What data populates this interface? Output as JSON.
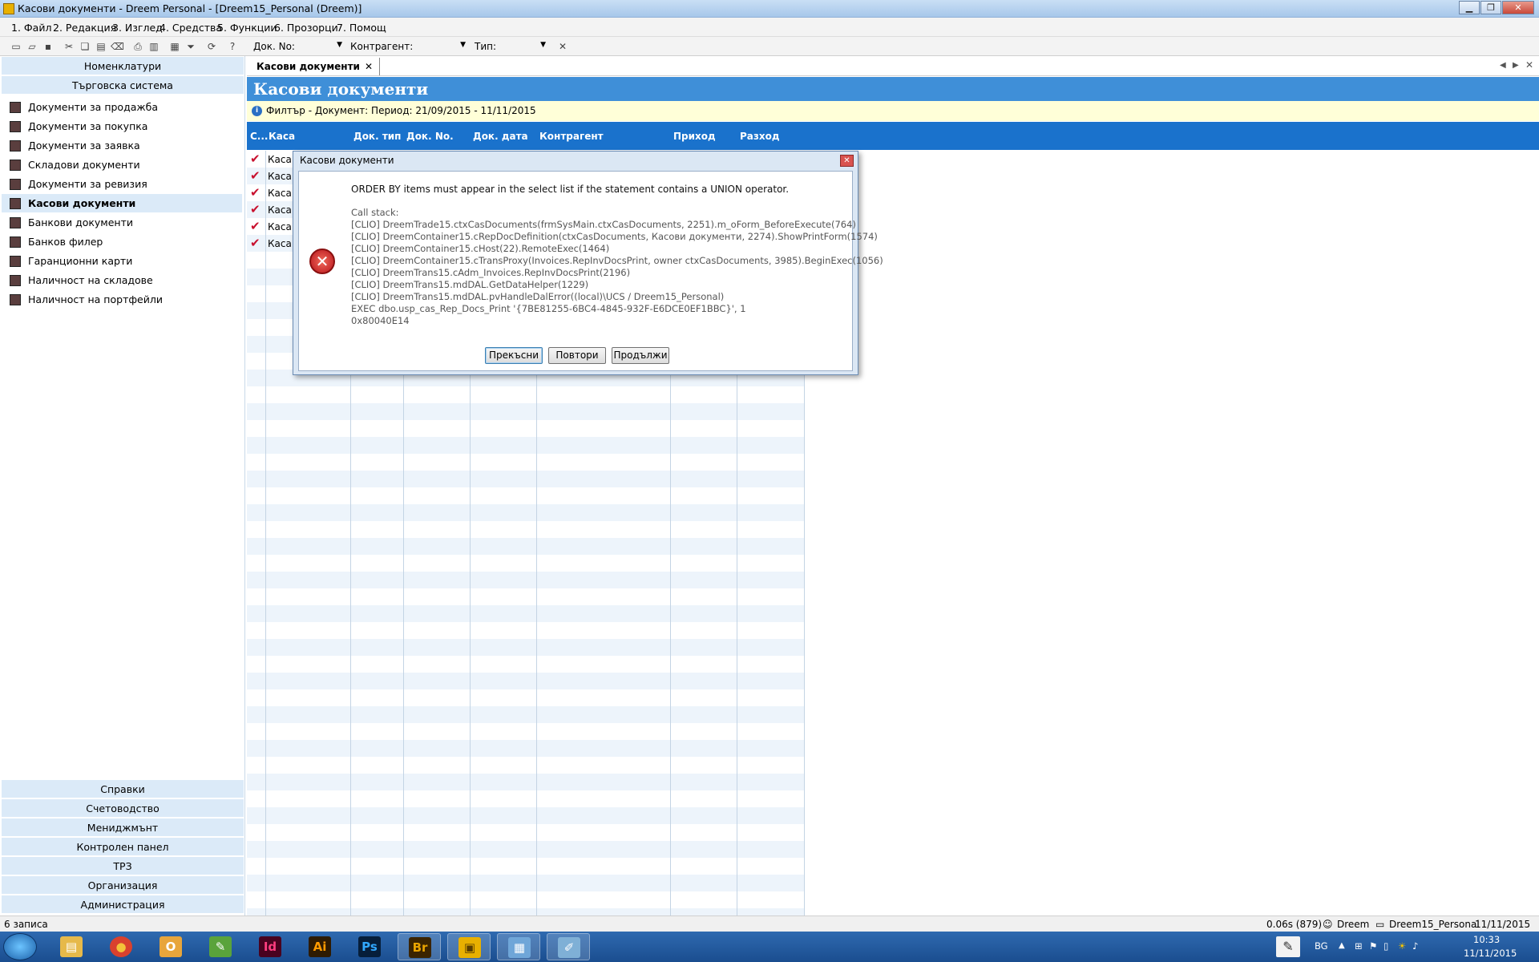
{
  "window": {
    "title": "Касови документи - Dreem Personal - [Dreem15_Personal (Dreem)]",
    "min_glyph": "▁",
    "restore_glyph": "❐",
    "close_glyph": "✕"
  },
  "menu": [
    "1. Файл",
    "2. Редакция",
    "3. Изглед",
    "4. Средства",
    "5. Функции",
    "6. Прозорци",
    "7. Помощ"
  ],
  "toolbar": {
    "doc_no_label": "Док. No:",
    "contragent_label": "Контрагент:",
    "type_label": "Тип:",
    "doc_no_value": "",
    "contragent_value": "",
    "type_value": "",
    "clear_glyph": "✕",
    "icons": [
      "new-icon",
      "open-icon",
      "save-icon",
      "cut-icon",
      "copy-icon",
      "paste-icon",
      "erase-icon",
      "print-icon",
      "print-preview-icon",
      "layout-icon",
      "filter-icon",
      "refresh-icon",
      "help-icon"
    ]
  },
  "sidebar": {
    "top_groups": [
      "Номенклатури",
      "Търговска система"
    ],
    "items": [
      {
        "label": "Документи за продажба",
        "active": false
      },
      {
        "label": "Документи за покупка",
        "active": false
      },
      {
        "label": "Документи за заявка",
        "active": false
      },
      {
        "label": "Складови документи",
        "active": false
      },
      {
        "label": "Документи за ревизия",
        "active": false
      },
      {
        "label": "Касови документи",
        "active": true
      },
      {
        "label": "Банкови документи",
        "active": false
      },
      {
        "label": "Банков филер",
        "active": false
      },
      {
        "label": "Гаранционни карти",
        "active": false
      },
      {
        "label": "Наличност на складове",
        "active": false
      },
      {
        "label": "Наличност на портфейли",
        "active": false
      }
    ],
    "bottom_groups": [
      "Справки",
      "Счетоводство",
      "Мениджмънт",
      "Контролен панел",
      "ТРЗ",
      "Организация",
      "Администрация"
    ]
  },
  "tab": {
    "label": "Касови документи",
    "close": "✕",
    "prev": "◀",
    "next": "▶",
    "close_all": "✕"
  },
  "banner": {
    "title": "Касови документи"
  },
  "filter": {
    "icon": "i",
    "text": "Филтър - Документ: Период: 21/09/2015 - 11/11/2015"
  },
  "grid": {
    "columns": [
      "С...",
      "Каса",
      "Док. тип",
      "Док. No.",
      "Док. дата",
      "Контрагент",
      "Приход",
      "Разход"
    ],
    "check_glyph": "✔",
    "rows": [
      {
        "kasa": "Каса"
      },
      {
        "kasa": "Каса"
      },
      {
        "kasa": "Каса"
      },
      {
        "kasa": "Каса"
      },
      {
        "kasa": "Каса"
      },
      {
        "kasa": "Каса"
      }
    ]
  },
  "dialog": {
    "title": "Касови документи",
    "close_glyph": "✕",
    "error_glyph": "✕",
    "message": "ORDER BY items must appear in the select list if the statement contains a UNION operator.",
    "stack_label": "Call stack:",
    "stack": [
      "[CLIO] DreemTrade15.ctxCasDocuments(frmSysMain.ctxCasDocuments, 2251).m_oForm_BeforeExecute(764)",
      "[CLIO] DreemContainer15.cRepDocDefinition(ctxCasDocuments, Касови документи, 2274).ShowPrintForm(1574)",
      "[CLIO] DreemContainer15.cHost(22).RemoteExec(1464)",
      "[CLIO] DreemContainer15.cTransProxy(Invoices.RepInvDocsPrint, owner ctxCasDocuments, 3985).BeginExec(1056)",
      "[CLIO] DreemTrans15.cAdm_Invoices.RepInvDocsPrint(2196)",
      "[CLIO] DreemTrans15.mdDAL.GetDataHelper(1229)",
      "[CLIO] DreemTrans15.mdDAL.pvHandleDalError((local)\\UCS / Dreem15_Personal)",
      "EXEC dbo.usp_cas_Rep_Docs_Print '{7BE81255-6BC4-4845-932F-E6DCE0EF1BBC}', 1",
      "0x80040E14"
    ],
    "buttons": [
      "Прекъсни",
      "Повтори",
      "Продължи"
    ]
  },
  "status": {
    "records": "6 записа",
    "timing": "0.06s (879)",
    "user": "Dreem",
    "database": "Dreem15_Personal",
    "date": "11/11/2015"
  },
  "taskbar": {
    "apps": [
      {
        "name": "explorer",
        "glyph": "▤",
        "color": "#e6b94a"
      },
      {
        "name": "chrome",
        "glyph": "●",
        "color": "#d9412e"
      },
      {
        "name": "outlook",
        "glyph": "O",
        "color": "#e8a53b"
      },
      {
        "name": "corel",
        "glyph": "✎",
        "color": "#5aa33b"
      },
      {
        "name": "indesign",
        "glyph": "Id",
        "color": "#49021f"
      },
      {
        "name": "illustrator",
        "glyph": "Ai",
        "color": "#2e1b02"
      },
      {
        "name": "photoshop",
        "glyph": "Ps",
        "color": "#061e3a"
      },
      {
        "name": "bridge",
        "glyph": "Br",
        "color": "#3b2400"
      },
      {
        "name": "dreem",
        "glyph": "▣",
        "color": "#e8b000"
      },
      {
        "name": "control-panel",
        "glyph": "▦",
        "color": "#6fa6d8"
      },
      {
        "name": "paint",
        "glyph": "✐",
        "color": "#7fb0d6"
      }
    ],
    "lang": "BG",
    "time": "10:33",
    "date": "11/11/2015"
  }
}
